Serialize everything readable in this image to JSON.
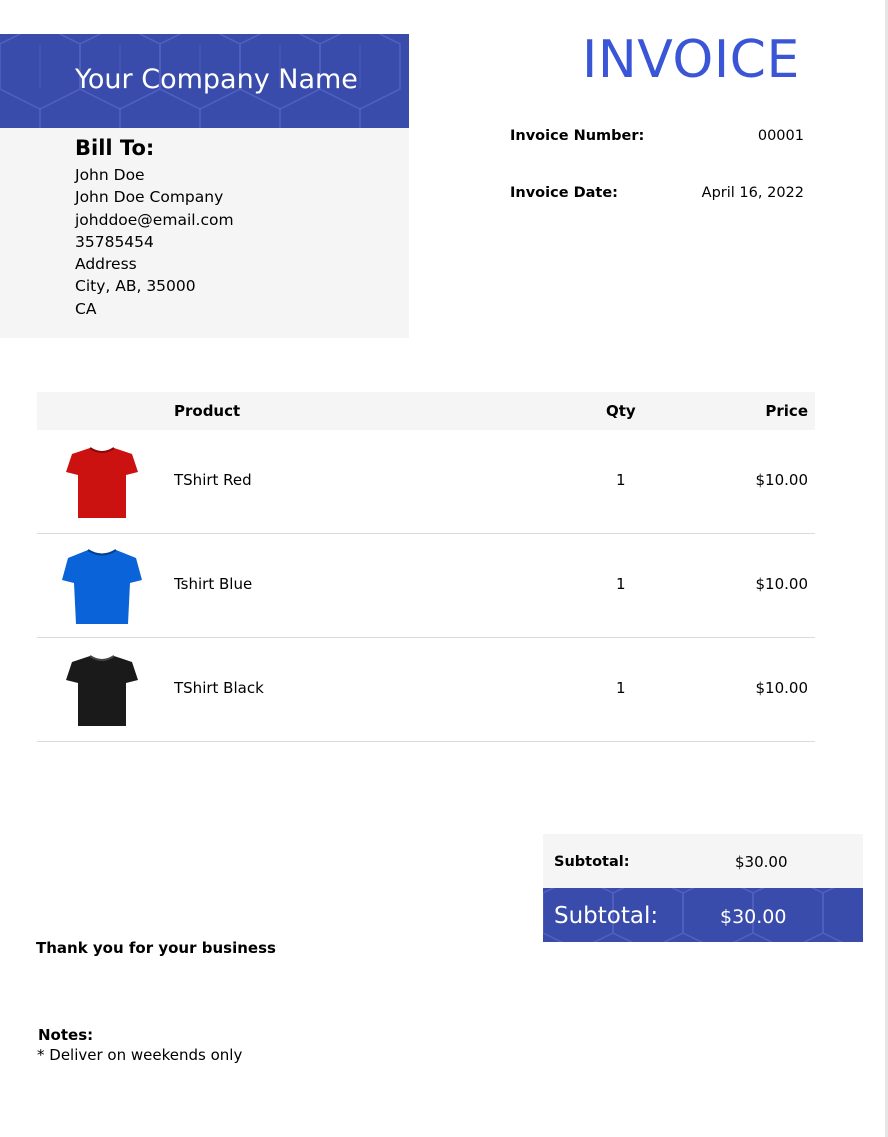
{
  "header": {
    "company_name": "Your Company Name",
    "title": "INVOICE",
    "brand_color": "#3a4cab",
    "title_color": "#3a55d6"
  },
  "bill_to": {
    "title": "Bill To:",
    "lines": [
      "John Doe",
      "John Doe Company",
      "johddoe@email.com",
      "35785454",
      "Address",
      "City, AB, 35000",
      "CA"
    ]
  },
  "meta": {
    "invoice_number_label": "Invoice Number:",
    "invoice_number": "00001",
    "invoice_date_label": "Invoice Date:",
    "invoice_date": "April 16, 2022"
  },
  "table": {
    "headers": {
      "product": "Product",
      "qty": "Qty",
      "price": "Price"
    },
    "rows": [
      {
        "name": "TShirt Red",
        "qty": "1",
        "price": "$10.00",
        "image": "tshirt-red",
        "color": "#cc1111"
      },
      {
        "name": "Tshirt Blue",
        "qty": "1",
        "price": "$10.00",
        "image": "tshirt-blue",
        "color": "#0a63d8"
      },
      {
        "name": "TShirt Black",
        "qty": "1",
        "price": "$10.00",
        "image": "tshirt-black",
        "color": "#1a1a1a"
      }
    ]
  },
  "totals": {
    "subtotal_label": "Subtotal:",
    "subtotal_value": "$30.00",
    "grand_label": "Subtotal:",
    "grand_value": "$30.00"
  },
  "footer": {
    "thanks": "Thank you for your business",
    "notes_title": "Notes:",
    "notes_text": "* Deliver on weekends only"
  }
}
